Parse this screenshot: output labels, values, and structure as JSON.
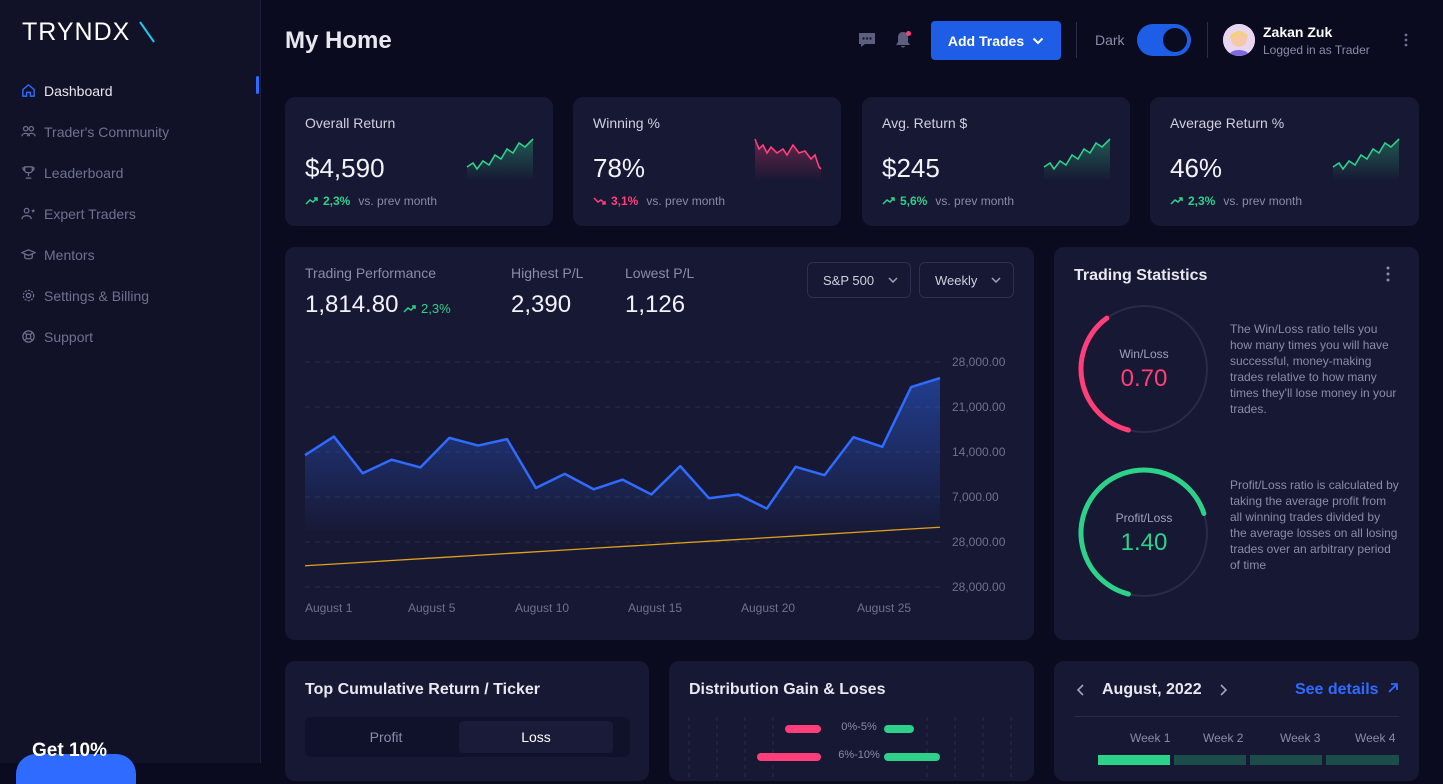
{
  "brand": {
    "logo_text": "TRYNDX"
  },
  "sidebar": {
    "items": [
      {
        "label": "Dashboard",
        "icon": "home-icon",
        "active": true
      },
      {
        "label": "Trader's Community",
        "icon": "users-icon"
      },
      {
        "label": "Leaderboard",
        "icon": "trophy-icon"
      },
      {
        "label": "Expert Traders",
        "icon": "user-star-icon"
      },
      {
        "label": "Mentors",
        "icon": "graduation-cap-icon"
      },
      {
        "label": "Settings & Billing",
        "icon": "gear-icon"
      },
      {
        "label": "Support",
        "icon": "lifebuoy-icon"
      }
    ],
    "promo_text": "Get 10%"
  },
  "header": {
    "title": "My Home",
    "add_trades_label": "Add Trades",
    "dark_label": "Dark",
    "dark_mode": true,
    "user_name": "Zakan Zuk",
    "user_role": "Logged in as Trader"
  },
  "kpis": [
    {
      "title": "Overall Return",
      "value": "$4,590",
      "delta": "2,3%",
      "trend": "up",
      "vs": "vs. prev month"
    },
    {
      "title": "Winning %",
      "value": "78%",
      "delta": "3,1%",
      "trend": "down",
      "vs": "vs. prev month"
    },
    {
      "title": "Avg. Return $",
      "value": "$245",
      "delta": "5,6%",
      "trend": "up",
      "vs": "vs. prev month"
    },
    {
      "title": "Average Return %",
      "value": "46%",
      "delta": "2,3%",
      "trend": "up",
      "vs": "vs. prev month"
    }
  ],
  "performance": {
    "label": "Trading Performance",
    "value": "1,814.80",
    "delta": "2,3%",
    "highest_label": "Highest P/L",
    "highest_value": "2,390",
    "lowest_label": "Lowest P/L",
    "lowest_value": "1,126",
    "index_select": "S&P 500",
    "period_select": "Weekly"
  },
  "chart_data": {
    "type": "area",
    "y_tick_labels": [
      "28,000.00",
      "21,000.00",
      "14,000.00",
      "7,000.00",
      "28,000.00",
      "28,000.00"
    ],
    "x_tick_labels": [
      "August 1",
      "August 5",
      "August 10",
      "August 15",
      "August 20",
      "August 25"
    ],
    "series": [
      {
        "values": [
          13500,
          16400,
          10700,
          12800,
          11600,
          16200,
          15000,
          16000,
          8400,
          10600,
          8200,
          9700,
          7400,
          11800,
          6800,
          7400,
          5200,
          11700,
          10400,
          16300,
          14800,
          24100,
          25500
        ],
        "color": "#2f6bff"
      },
      {
        "values": [
          -3700,
          -3300,
          -2900,
          -2500,
          -2100,
          -1700,
          -1300,
          -900,
          -500,
          -100,
          300,
          700,
          1100,
          1500,
          1900,
          2300
        ],
        "color": "#e0a21b"
      }
    ],
    "grid": true
  },
  "stats": {
    "title": "Trading Statistics",
    "win_loss_label": "Win/Loss",
    "win_loss_value": "0.70",
    "win_loss_ratio": 0.36,
    "win_loss_desc": "The Win/Loss ratio tells you how many times you will have successful, money-making trades relative to how many times they'll lose money in your trades.",
    "profit_loss_label": "Profit/Loss",
    "profit_loss_value": "1.40",
    "profit_loss_ratio": 0.66,
    "profit_loss_desc": "Profit/Loss ratio is calculated by taking the average profit from all winning trades divided by the average losses on all losing trades over an arbitrary period of time"
  },
  "cumulative": {
    "title": "Top Cumulative Return / Ticker",
    "tab_profit": "Profit",
    "tab_loss": "Loss"
  },
  "distribution": {
    "title": "Distribution Gain & Loses",
    "rows": [
      {
        "label": "0%-5%"
      },
      {
        "label": "6%-10%"
      }
    ]
  },
  "calendar": {
    "month": "August, 2022",
    "see_details": "See details",
    "weeks": [
      "Week 1",
      "Week 2",
      "Week 3",
      "Week 4"
    ]
  },
  "colors": {
    "accent": "#1e5ee6",
    "up": "#2ed18a",
    "down": "#ff3e7a"
  }
}
